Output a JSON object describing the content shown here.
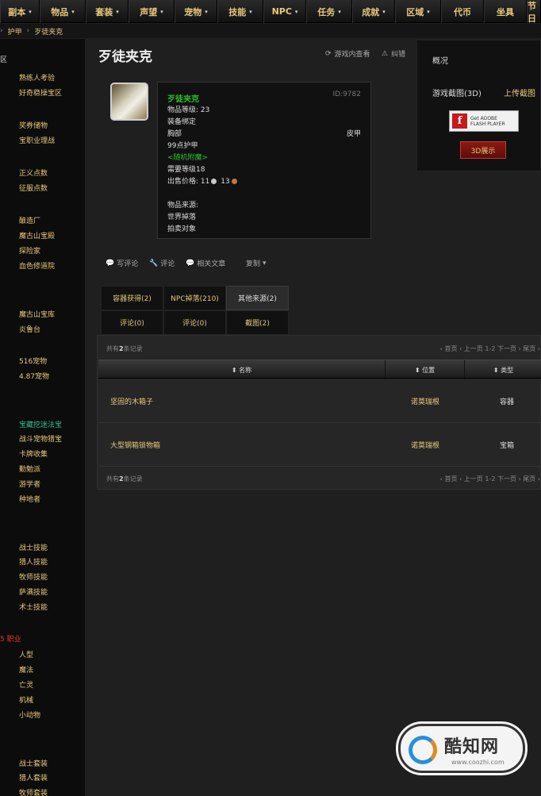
{
  "nav": [
    {
      "label": "副本",
      "caret": "▾"
    },
    {
      "label": "物品",
      "caret": "▾"
    },
    {
      "label": "套装",
      "caret": "▾"
    },
    {
      "label": "声望",
      "caret": "▾"
    },
    {
      "label": "宠物",
      "caret": "▾"
    },
    {
      "label": "技能",
      "caret": "▾"
    },
    {
      "label": "NPC",
      "caret": "▾"
    },
    {
      "label": "任务",
      "caret": "▾"
    },
    {
      "label": "成就",
      "caret": "▾"
    },
    {
      "label": "区域",
      "caret": "▾"
    },
    {
      "label": "代币",
      "caret": ""
    },
    {
      "label": "坐具",
      "caret": ""
    },
    {
      "label": "节日",
      "caret": ""
    }
  ],
  "breadcrumb": [
    "护甲",
    "歹徒夹克"
  ],
  "sidebar": {
    "sections": [
      {
        "label": "区",
        "red": false
      },
      {
        "label": "",
        "red": true
      },
      {
        "label": "",
        "red": true
      },
      {
        "label": "",
        "red": true
      },
      {
        "label": "",
        "red": false
      },
      {
        "label": "",
        "red": false
      },
      {
        "label": "",
        "red": false
      },
      {
        "label": "",
        "red": false
      },
      {
        "label": "",
        "red": false
      },
      {
        "label": "5 职业",
        "red": true
      }
    ],
    "items": [
      "熟练人考验",
      "好奇稳操宝区",
      "奖券储物",
      "宝职业理战",
      "正义点数",
      "征服点数",
      "酿造厂",
      "魔古山宝殿",
      "探险家",
      "血色修道院",
      "魔古山宝库",
      "炎鲁台",
      "516宠物",
      "4.87宠物",
      "宝藏挖迷法宝",
      "战斗宠物猎宝",
      "卡牌收集",
      "勤勉派",
      "游学者",
      "种地者",
      "战士技能",
      "猎人技能",
      "牧师技能",
      "萨满技能",
      "术士技能",
      "人型",
      "魔法",
      "亡灵",
      "机械",
      "小动物",
      "战士套装",
      "猎人套装",
      "牧师套装"
    ]
  },
  "page": {
    "title": "歹徒夹克",
    "action_1": "游戏内查看",
    "action_2": "纠错"
  },
  "tooltip": {
    "name": "歹徒夹克",
    "id": "ID:9782",
    "level": "物品等级: 23",
    "bind": "装备绑定",
    "slot": "胸部",
    "armor_type": "皮甲",
    "armor": "99点护甲",
    "random": "<随机附魔>",
    "req": "需要等级18",
    "sell_label": "出售价格:",
    "silver": "11",
    "copper": "13",
    "source_label": "物品来源:",
    "source_1": "世界掉落",
    "source_2": "拍卖对象"
  },
  "links": {
    "comment": "写评论",
    "review": "评论",
    "related": "相关文章",
    "copy": "复制"
  },
  "panel": {
    "title": "概况",
    "view_label": "游戏截图(3D)",
    "view_link": "上传截图",
    "flash_line1": "Get ADOBE",
    "flash_line2": "FLASH PLAYER",
    "btn_3d": "3D展示"
  },
  "tabs": [
    {
      "label": "容器获得(2)",
      "active": false
    },
    {
      "label": "NPC掉落(210)",
      "active": false
    },
    {
      "label": "其他来源(2)",
      "active": true
    },
    {
      "label": "评论(0)",
      "active": false
    },
    {
      "label": "评论(0)",
      "active": false
    },
    {
      "label": "截图(2)",
      "active": false
    }
  ],
  "table": {
    "summary_prefix": "共有",
    "summary_count": "2",
    "summary_suffix": "条记录",
    "pager": "‹ 首页 ‹ 上一页 1-2 下一页 › 尾页 ›",
    "headers": [
      "名称",
      "位置",
      "类型"
    ],
    "rows": [
      {
        "name": "坚固的木箱子",
        "pos": "诺莫瑞根",
        "type": "容器"
      },
      {
        "name": "大型钢箱锁物箱",
        "pos": "诺莫瑞根",
        "type": "宝箱"
      }
    ]
  },
  "watermark": {
    "brand": "酷知网",
    "url": "www.coozhi.com"
  }
}
